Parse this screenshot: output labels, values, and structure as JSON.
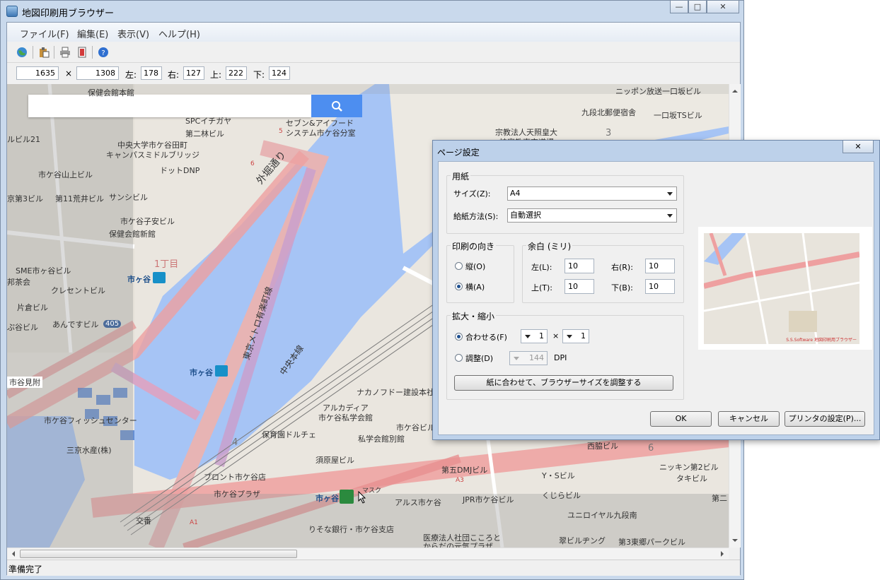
{
  "window": {
    "title": "地図印刷用ブラウザー",
    "minimize": "—",
    "maximize": "□",
    "close": "✕"
  },
  "menu": [
    "ファイル(F)",
    "編集(E)",
    "表示(V)",
    "ヘルプ(H)"
  ],
  "toolbar": {
    "icons": [
      "globe-icon",
      "paste-icon",
      "print-icon",
      "print-preview-icon",
      "help-icon"
    ]
  },
  "sizebar": {
    "width": "1635",
    "times": "×",
    "height": "1308",
    "left_label": "左:",
    "left": "178",
    "right_label": "右:",
    "right": "127",
    "top_label": "上:",
    "top": "222",
    "bottom_label": "下:",
    "bottom": "124"
  },
  "map": {
    "labels": [
      "保健会館本館",
      "SPCイチガヤ",
      "セブン&アイフード",
      "システム市ケ谷分室",
      "第二林ビル",
      "中央大学市ケ谷田町",
      "キャンパスミドルブリッジ",
      "ドットDNP",
      "外堀通り",
      "市ケ谷山上ビル",
      "第11荒井ビル",
      "サンシビル",
      "市ケ谷子安ビル",
      "保健会館新館",
      "1丁目",
      "SME市ヶ谷ビル",
      "市ヶ谷",
      "クレセントビル",
      "片倉ビル",
      "あんですビル",
      "405",
      "東京メトロ有楽町線",
      "中央本線",
      "市谷見附",
      "市ヶ谷",
      "ナカノフドー建設本社",
      "アルカディア",
      "市ケ谷私学会館",
      "市ケ谷フィッシュセンター",
      "三京水産(株)",
      "保育園ドルチェ",
      "私学会館別館",
      "市ケ谷ビル",
      "4",
      "須原屋ビル",
      "プロント市ケ谷店",
      "市ケ谷プラザ",
      "市ヶ谷",
      "マスク",
      "アルス市ケ谷",
      "JPR市ケ谷ビル",
      "第五DMJビル",
      "A3",
      "Y・Sビル",
      "くじらビル",
      "ユニロイヤル九段南",
      "交番",
      "A1",
      "りそな銀行・市ケ谷支店",
      "医療法人社団こころと",
      "からだの元気プラザ",
      "翠ビルヂング",
      "第3東郷パークビル",
      "ニッキン第2ビル",
      "タキビル",
      "第二",
      "西脇ビル",
      "6",
      "ニッポン放送一口坂ビル",
      "九段北郵便宿舎",
      "一口坂TSビル",
      "宗教法人天照皇大",
      "神宮教東京道場",
      "3",
      "ルビル21",
      "京第3ビル",
      "邦茶会",
      "ぷ谷ビル",
      "5",
      "6"
    ]
  },
  "status": "準備完了",
  "dialog": {
    "title": "ページ設定",
    "close": "✕",
    "paper": {
      "group": "用紙",
      "size_label": "サイズ(Z):",
      "size_value": "A4",
      "source_label": "給紙方法(S):",
      "source_value": "自動選択"
    },
    "orientation": {
      "group": "印刷の向き",
      "portrait": "縦(O)",
      "landscape": "横(A)",
      "selected": "landscape"
    },
    "margins": {
      "group": "余白 (ミリ)",
      "left_label": "左(L):",
      "left": "10",
      "right_label": "右(R):",
      "right": "10",
      "top_label": "上(T):",
      "top": "10",
      "bottom_label": "下(B):",
      "bottom": "10"
    },
    "scale": {
      "group": "拡大・縮小",
      "fit_label": "合わせる(F)",
      "fit_x": "1",
      "times": "×",
      "fit_y": "1",
      "adjust_label": "調整(D)",
      "dpi_value": "144",
      "dpi_unit": "DPI",
      "fit_button": "紙に合わせて、ブラウザーサイズを調整する"
    },
    "preview_caption": "S.S.Software 地図印刷用ブラウザー",
    "ok": "OK",
    "cancel": "キャンセル",
    "printer": "プリンタの設定(P)..."
  }
}
